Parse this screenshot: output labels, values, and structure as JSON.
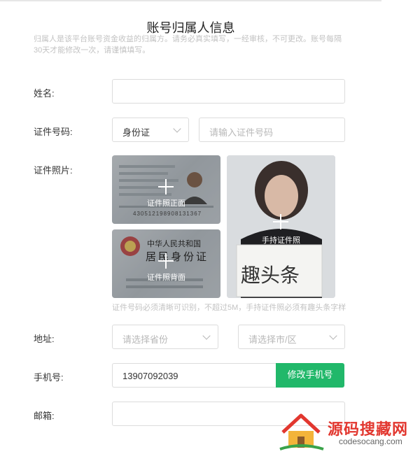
{
  "form": {
    "title": "账号归属人信息",
    "description": "归属人是该平台账号资金收益的归属方。请务必真实填写，一经审核，不可更改。账号每隔30天才能修改一次，请谨慎填写。",
    "name_label": "姓名:",
    "name_value": "",
    "id_label": "证件号码:",
    "id_type": "身份证",
    "id_placeholder": "请输入证件号码",
    "photo_label": "证件照片:",
    "photo_front_caption": "证件照正面",
    "photo_back_caption": "证件照背面",
    "photo_handheld_caption": "手持证件照",
    "photo_hint": "证件号码必须清晰可识别，不超过5M，手持证件照必须有趣头条字样",
    "address_label": "地址:",
    "province_placeholder": "请选择省份",
    "city_placeholder": "请选择市/区",
    "phone_label": "手机号:",
    "phone_value": "13907092039",
    "change_phone_button": "修改手机号",
    "email_label": "邮箱:",
    "email_value": ""
  },
  "id_card_front": {
    "id_number": "430512198908131367"
  },
  "id_card_back": {
    "country": "中华人民共和国",
    "card_title": "居民身份证"
  },
  "handheld_sign": "趣头条",
  "watermark": {
    "brand": "源码搜藏网",
    "url": "codesocang.com"
  },
  "colors": {
    "accent_green": "#21b86a",
    "watermark_red": "#e2372f"
  }
}
